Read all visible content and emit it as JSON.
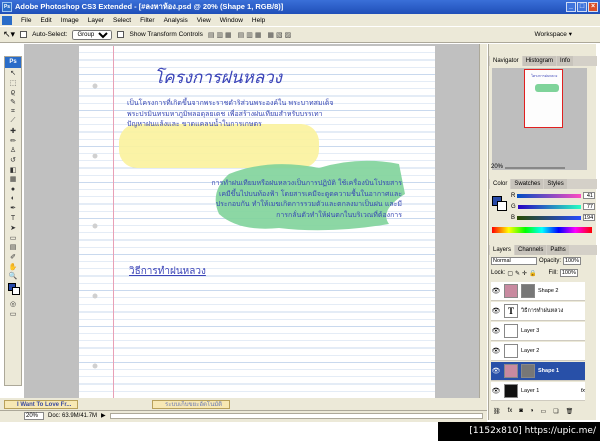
{
  "title": "Adobe Photoshop CS3 Extended - [#ลงหาห้อง.psd @ 20% (Shape 1, RGB/8)]",
  "menu": [
    "File",
    "Edit",
    "Image",
    "Layer",
    "Select",
    "Filter",
    "Analysis",
    "View",
    "Window",
    "Help"
  ],
  "options": {
    "auto_select": "Auto-Select:",
    "group": "Group",
    "show_transform": "Show Transform Controls",
    "workspace": "Workspace ▾"
  },
  "document": {
    "title": "โครงการฝนหลวง",
    "para1": "เป็นโครงการที่เกิดขึ้นจากพระราชดำริส่วนพระองค์ใน พระบาทสมเด็จพระปรมินทรมหาภูมิพลอดุลยเดช เพื่อสร้างฝนเทียมสำหรับบรรเทาปัญหาฝนแล้งและ ขาดแคลนน้ำในการเกษตร",
    "para2": "การทำฝนเทียมหรือฝนหลวงเป็นการปฏิบัติ ใช้เครื่องบินโปรยสารเคมีขึ้นไปบนท้องฟ้า โดยสารเคมีจะดูดความชื้นในอากาศและประกอบกัน ทำให้เมฆเกิดการรวมตัวและตกลงมาเป็นฝน และมีการกลั่นตัวทำให้ฝนตกในบริเวณที่ต้องการ",
    "subtitle": "วิธีการทำฝนหลวง"
  },
  "tabs": {
    "doc1": "I Want To Love Fr...",
    "doc2": "ระบบเก็บขยะอัตโนมัติ"
  },
  "status": {
    "zoom": "20%",
    "doc": "Doc: 63.9M/41.7M"
  },
  "navigator": {
    "tabs": [
      "Navigator",
      "Histogram",
      "Info"
    ],
    "zoom": "20%"
  },
  "color": {
    "tabs": [
      "Color",
      "Swatches",
      "Styles"
    ],
    "r": "41",
    "g": "77",
    "b": "194",
    "foreground": "#294dc2"
  },
  "layers": {
    "tabs": [
      "Layers",
      "Channels",
      "Paths"
    ],
    "blend": "Normal",
    "opacity_label": "Opacity:",
    "opacity": "100%",
    "lock": "Lock:",
    "fill_label": "Fill:",
    "fill": "100%",
    "items": [
      {
        "name": "Shape 2",
        "thumb": "",
        "text": ""
      },
      {
        "name": "วิธีการทำฝนหลวง",
        "thumb": "T",
        "text": "T"
      },
      {
        "name": "Layer 3",
        "thumb": "",
        "text": ""
      },
      {
        "name": "Layer 2",
        "thumb": "",
        "text": ""
      },
      {
        "name": "Shape 1",
        "thumb": "",
        "text": ""
      },
      {
        "name": "Layer 1",
        "thumb": "",
        "text": ""
      }
    ]
  },
  "credit": "[1152x810] https://upic.me/"
}
